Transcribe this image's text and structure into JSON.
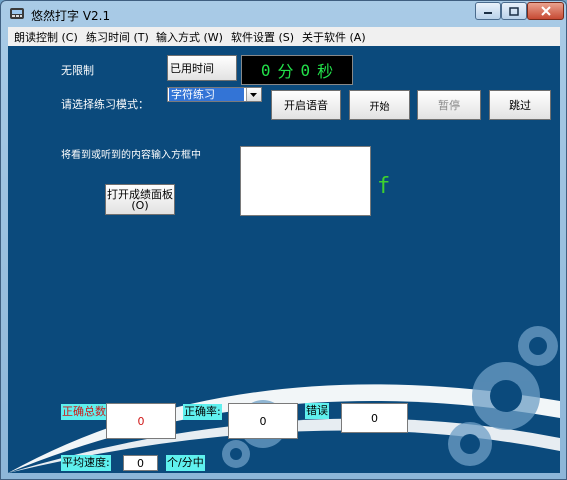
{
  "window": {
    "title": "悠然打字 V2.1"
  },
  "menu": {
    "items": [
      {
        "label": "朗读控制 (C)"
      },
      {
        "label": "练习时间 (T)"
      },
      {
        "label": "输入方式 (W)"
      },
      {
        "label": "软件设置 (S)"
      },
      {
        "label": "关于软件 (A)"
      }
    ]
  },
  "main": {
    "limit_label": "无限制",
    "time_used_button": "已用时间",
    "timer": {
      "minutes": "0",
      "minutes_unit": "分",
      "seconds": "0",
      "seconds_unit": "秒"
    },
    "mode_label": "请选择练习模式：",
    "mode_select": {
      "value": "字符练习"
    },
    "voice_button": "开启语音",
    "start_button": "开始",
    "pause_button": "暂停",
    "skip_button": "跳过",
    "input_prompt": "将看到或听到的内容输入方框中",
    "open_panel_button": "打开成绩面板",
    "open_panel_shortcut": "(O)",
    "target_char": "f"
  },
  "stats": {
    "correct_total_label": "正确总数",
    "correct_total_value": "0",
    "accuracy_label": "正确率:",
    "accuracy_value": "0",
    "errors_label": "错误",
    "errors_value": "0",
    "speed_label": "平均速度:",
    "speed_value": "0",
    "speed_unit": "个/分中"
  },
  "colors": {
    "background": "#0b4a7c",
    "timer_text": "#22e04a",
    "target_char": "#3ed12e",
    "stat_label_bg": "#5ff0ee",
    "correct_total_label": "#d01818",
    "correct_value": "#d01818"
  }
}
